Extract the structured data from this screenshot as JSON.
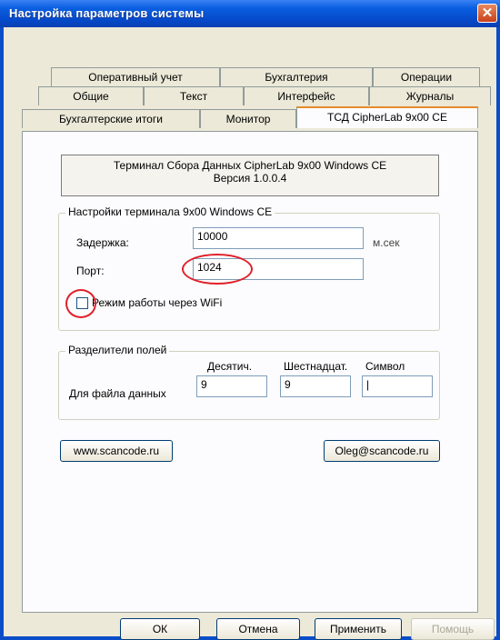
{
  "window": {
    "title": "Настройка параметров системы"
  },
  "tabs": {
    "row1": [
      "Оперативный учет",
      "Бухгалтерия",
      "Операции"
    ],
    "row2": [
      "Общие",
      "Текст",
      "Интерфейс",
      "Журналы"
    ],
    "row3": [
      "Бухгалтерские итоги",
      "Монитор",
      "ТСД CipherLab 9x00 CE"
    ]
  },
  "info": {
    "line1": "Терминал Сбора Данных CipherLab 9x00 Windows CE",
    "line2": "Версия 1.0.0.4"
  },
  "terminal_settings": {
    "title": "Настройки терминала 9x00 Windows CE",
    "delay_label": "Задержка:",
    "delay_value": "10000",
    "delay_unit": "м.сек",
    "port_label": "Порт:",
    "port_value": "1024",
    "wifi_label": "Режим работы через WiFi",
    "wifi_checked": false
  },
  "separators": {
    "title": "Разделители полей",
    "col_decimal": "Десятич.",
    "col_hex": "Шестнадцат.",
    "col_symbol": "Символ",
    "row_label": "Для файла данных",
    "decimal_value": "9",
    "hex_value": "9",
    "symbol_value": "|"
  },
  "links": {
    "site": "www.scancode.ru",
    "email": "Oleg@scancode.ru"
  },
  "buttons": {
    "ok": "ОК",
    "cancel": "Отмена",
    "apply": "Применить",
    "help": "Помощь"
  },
  "colors": {
    "titlebar": "#0a5fe0",
    "highlight_ring": "#e0202a",
    "active_tab_accent": "#e68b2c"
  }
}
